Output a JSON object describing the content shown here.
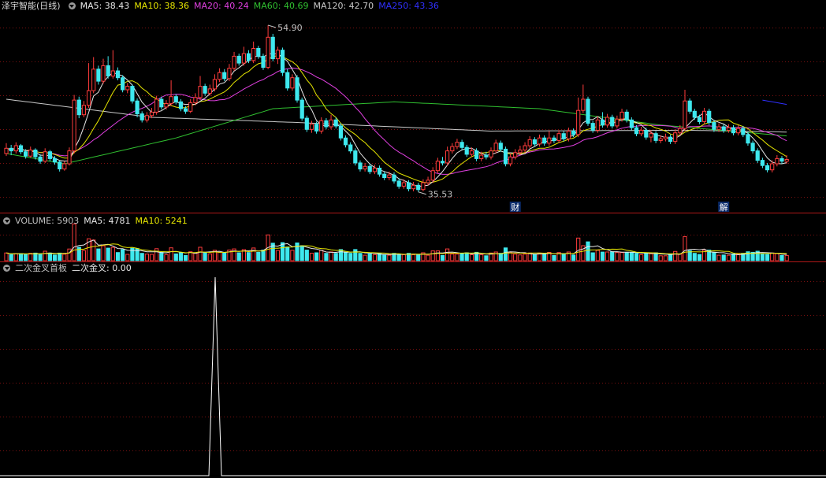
{
  "panel_main": {
    "title": "泽宇智能(日线)",
    "ma_labels": [
      {
        "text": "MA5: 38.43",
        "color": "#e8e8e8"
      },
      {
        "text": "MA10: 38.36",
        "color": "#e6e600"
      },
      {
        "text": "MA20: 40.24",
        "color": "#e040e0"
      },
      {
        "text": "MA60: 40.69",
        "color": "#30c030"
      },
      {
        "text": "MA120: 42.70",
        "color": "#c8c8c8"
      },
      {
        "text": "MA250: 43.36",
        "color": "#3030ff"
      }
    ],
    "high_label": "54.90",
    "low_label": "35.53",
    "markers": [
      "财",
      "解"
    ]
  },
  "panel_volume": {
    "labels": [
      {
        "text": "VOLUME: 5903",
        "color": "#c0c0c0"
      },
      {
        "text": "MA5: 4781",
        "color": "#e8e8e8"
      },
      {
        "text": "MA10: 5241",
        "color": "#e6e600"
      }
    ]
  },
  "panel_indicator": {
    "labels": [
      {
        "text": "二次金叉首板",
        "color": "#c0c0c0"
      },
      {
        "text": "二次金叉: 0.00",
        "color": "#e8e8e8"
      }
    ]
  },
  "colors": {
    "up": "#ff3c3c",
    "down": "#3ee8ee",
    "grid": "#7a1010",
    "separator": "#b01818",
    "spike": "#ffffff"
  },
  "chart_data": {
    "type": "candlestick",
    "price_range": [
      35.53,
      54.9
    ],
    "grid": "dotted horizontal",
    "candles": [
      [
        40.0,
        40.6,
        41.2,
        39.7
      ],
      [
        40.6,
        40.3,
        41.0,
        39.8
      ],
      [
        40.3,
        40.9,
        41.3,
        40.0
      ],
      [
        40.9,
        40.2,
        41.1,
        39.9
      ],
      [
        40.2,
        39.7,
        40.5,
        39.4
      ],
      [
        39.7,
        40.4,
        40.8,
        39.5
      ],
      [
        40.4,
        39.6,
        40.6,
        39.3
      ],
      [
        39.6,
        39.1,
        39.9,
        38.8
      ],
      [
        39.1,
        40.2,
        40.6,
        38.9
      ],
      [
        40.2,
        39.4,
        40.4,
        39.1
      ],
      [
        39.4,
        39.0,
        39.7,
        38.7
      ],
      [
        39.0,
        38.2,
        39.2,
        37.9
      ],
      [
        38.2,
        38.8,
        39.1,
        38.0
      ],
      [
        38.8,
        40.3,
        40.7,
        38.6
      ],
      [
        40.3,
        46.2,
        46.8,
        40.0
      ],
      [
        46.2,
        44.5,
        46.6,
        44.1
      ],
      [
        44.5,
        45.6,
        46.1,
        44.2
      ],
      [
        45.6,
        47.3,
        50.5,
        45.3
      ],
      [
        47.3,
        49.8,
        51.2,
        47.0
      ],
      [
        49.8,
        48.4,
        50.2,
        48.0
      ],
      [
        48.4,
        50.2,
        51.0,
        48.1
      ],
      [
        50.2,
        49.0,
        51.3,
        48.7
      ],
      [
        49.0,
        49.6,
        52.0,
        48.7
      ],
      [
        49.6,
        48.8,
        50.0,
        48.5
      ],
      [
        48.8,
        47.4,
        49.1,
        47.1
      ],
      [
        47.4,
        47.8,
        48.2,
        47.0
      ],
      [
        47.8,
        46.1,
        48.0,
        45.8
      ],
      [
        46.1,
        44.6,
        46.4,
        44.2
      ],
      [
        44.6,
        43.9,
        44.9,
        43.6
      ],
      [
        43.9,
        44.4,
        44.8,
        43.6
      ],
      [
        44.4,
        44.8,
        45.3,
        44.1
      ],
      [
        44.8,
        46.3,
        46.7,
        44.5
      ],
      [
        46.3,
        45.4,
        46.6,
        45.1
      ],
      [
        45.4,
        45.8,
        46.2,
        45.1
      ],
      [
        45.8,
        46.6,
        48.5,
        45.5
      ],
      [
        46.6,
        46.0,
        46.9,
        45.7
      ],
      [
        46.0,
        45.2,
        46.3,
        44.9
      ],
      [
        45.2,
        44.9,
        45.5,
        44.6
      ],
      [
        44.9,
        45.9,
        46.3,
        44.7
      ],
      [
        45.9,
        46.5,
        47.0,
        45.6
      ],
      [
        46.5,
        47.8,
        49.0,
        46.2
      ],
      [
        47.8,
        47.0,
        48.1,
        46.7
      ],
      [
        47.0,
        47.5,
        48.0,
        46.7
      ],
      [
        47.5,
        48.6,
        49.2,
        47.2
      ],
      [
        48.6,
        49.4,
        49.9,
        48.3
      ],
      [
        49.4,
        48.7,
        49.8,
        48.4
      ],
      [
        48.7,
        49.9,
        50.4,
        48.4
      ],
      [
        49.9,
        51.3,
        51.8,
        49.6
      ],
      [
        51.3,
        50.5,
        51.6,
        50.2
      ],
      [
        50.5,
        51.6,
        52.4,
        50.2
      ],
      [
        51.6,
        50.8,
        52.0,
        50.5
      ],
      [
        50.8,
        52.2,
        53.0,
        50.5
      ],
      [
        52.2,
        51.3,
        52.5,
        51.0
      ],
      [
        51.3,
        50.0,
        51.6,
        49.7
      ],
      [
        50.0,
        53.5,
        54.9,
        49.8
      ],
      [
        53.5,
        51.0,
        53.9,
        50.7
      ],
      [
        51.0,
        52.0,
        52.4,
        50.4
      ],
      [
        52.0,
        49.4,
        52.3,
        49.0
      ],
      [
        49.4,
        47.6,
        49.8,
        47.3
      ],
      [
        47.6,
        48.8,
        49.2,
        47.3
      ],
      [
        48.8,
        46.2,
        49.1,
        45.9
      ],
      [
        46.2,
        44.1,
        46.5,
        43.8
      ],
      [
        44.1,
        42.8,
        44.4,
        42.5
      ],
      [
        42.8,
        43.4,
        43.8,
        42.4
      ],
      [
        43.4,
        42.6,
        43.7,
        42.3
      ],
      [
        42.6,
        43.8,
        44.2,
        42.3
      ],
      [
        43.8,
        43.1,
        44.1,
        42.8
      ],
      [
        43.1,
        43.9,
        44.5,
        42.8
      ],
      [
        43.9,
        43.2,
        44.2,
        42.9
      ],
      [
        43.2,
        41.8,
        43.5,
        41.5
      ],
      [
        41.8,
        41.0,
        42.1,
        40.7
      ],
      [
        41.0,
        40.3,
        41.3,
        40.0
      ],
      [
        40.3,
        38.9,
        40.6,
        38.6
      ],
      [
        38.9,
        38.2,
        39.2,
        37.9
      ],
      [
        38.2,
        38.5,
        38.9,
        37.9
      ],
      [
        38.5,
        37.9,
        38.8,
        37.6
      ],
      [
        37.9,
        38.3,
        38.7,
        37.6
      ],
      [
        38.3,
        37.6,
        38.6,
        37.3
      ],
      [
        37.6,
        37.2,
        37.9,
        36.9
      ],
      [
        37.2,
        37.5,
        37.9,
        36.9
      ],
      [
        37.5,
        36.8,
        37.8,
        36.5
      ],
      [
        36.8,
        36.2,
        37.1,
        35.9
      ],
      [
        36.2,
        36.6,
        37.0,
        35.9
      ],
      [
        36.6,
        35.9,
        36.9,
        35.6
      ],
      [
        35.9,
        36.3,
        36.7,
        35.6
      ],
      [
        36.3,
        35.8,
        36.6,
        35.53
      ],
      [
        35.8,
        36.6,
        37.0,
        35.6
      ],
      [
        36.6,
        36.9,
        37.3,
        36.3
      ],
      [
        36.9,
        38.0,
        38.4,
        36.6
      ],
      [
        38.0,
        39.1,
        39.5,
        37.7
      ],
      [
        39.1,
        38.9,
        39.6,
        38.6
      ],
      [
        38.9,
        40.3,
        40.8,
        38.6
      ],
      [
        40.3,
        40.8,
        41.2,
        40.0
      ],
      [
        40.8,
        41.3,
        41.7,
        40.5
      ],
      [
        41.3,
        40.7,
        41.6,
        40.4
      ],
      [
        40.7,
        39.9,
        41.0,
        39.6
      ],
      [
        39.9,
        40.3,
        40.7,
        39.6
      ],
      [
        40.3,
        39.4,
        40.6,
        39.1
      ],
      [
        39.4,
        39.8,
        40.2,
        39.1
      ],
      [
        39.8,
        39.6,
        40.2,
        39.3
      ],
      [
        39.6,
        40.3,
        40.7,
        39.3
      ],
      [
        40.3,
        41.2,
        41.6,
        40.0
      ],
      [
        41.2,
        40.5,
        41.5,
        40.2
      ],
      [
        40.5,
        38.8,
        40.8,
        38.5
      ],
      [
        38.8,
        39.6,
        40.0,
        38.5
      ],
      [
        39.6,
        40.1,
        40.5,
        39.3
      ],
      [
        40.1,
        40.4,
        40.9,
        39.8
      ],
      [
        40.4,
        40.9,
        41.3,
        40.1
      ],
      [
        40.9,
        41.6,
        42.0,
        40.6
      ],
      [
        41.6,
        41.1,
        41.9,
        40.8
      ],
      [
        41.1,
        41.8,
        42.2,
        40.8
      ],
      [
        41.8,
        41.2,
        42.1,
        40.9
      ],
      [
        41.2,
        41.8,
        42.6,
        40.9
      ],
      [
        41.8,
        41.5,
        42.1,
        41.2
      ],
      [
        41.5,
        42.3,
        42.7,
        41.2
      ],
      [
        42.3,
        41.7,
        42.6,
        41.4
      ],
      [
        41.7,
        42.6,
        43.0,
        41.4
      ],
      [
        42.6,
        42.2,
        42.9,
        41.9
      ],
      [
        42.2,
        45.0,
        46.5,
        41.9
      ],
      [
        45.0,
        46.3,
        48.0,
        44.7
      ],
      [
        46.3,
        43.5,
        46.6,
        43.2
      ],
      [
        43.5,
        42.7,
        43.8,
        42.4
      ],
      [
        42.7,
        43.9,
        44.3,
        42.4
      ],
      [
        43.9,
        43.3,
        44.8,
        43.0
      ],
      [
        43.3,
        44.2,
        44.6,
        43.0
      ],
      [
        44.2,
        43.2,
        44.5,
        42.9
      ],
      [
        43.2,
        44.0,
        44.4,
        42.9
      ],
      [
        44.0,
        44.8,
        45.2,
        43.7
      ],
      [
        44.8,
        43.9,
        45.1,
        43.6
      ],
      [
        43.9,
        43.0,
        44.2,
        42.7
      ],
      [
        43.0,
        42.3,
        43.3,
        42.0
      ],
      [
        42.3,
        42.7,
        43.1,
        42.0
      ],
      [
        42.7,
        41.9,
        43.0,
        41.6
      ],
      [
        41.9,
        42.3,
        42.7,
        41.3
      ],
      [
        42.3,
        41.5,
        42.6,
        41.2
      ],
      [
        41.5,
        41.7,
        42.1,
        41.2
      ],
      [
        41.7,
        41.9,
        42.3,
        41.4
      ],
      [
        41.9,
        41.4,
        42.2,
        41.1
      ],
      [
        41.4,
        42.4,
        42.8,
        41.1
      ],
      [
        42.4,
        42.9,
        43.3,
        42.1
      ],
      [
        42.9,
        46.1,
        47.4,
        42.6
      ],
      [
        46.1,
        44.9,
        46.4,
        44.6
      ],
      [
        44.9,
        44.2,
        45.2,
        43.9
      ],
      [
        44.2,
        43.7,
        44.5,
        43.4
      ],
      [
        43.7,
        44.9,
        45.3,
        43.4
      ],
      [
        44.9,
        43.6,
        45.2,
        43.3
      ],
      [
        43.6,
        42.8,
        43.9,
        42.5
      ],
      [
        42.8,
        43.1,
        43.5,
        42.5
      ],
      [
        43.1,
        42.7,
        43.4,
        42.4
      ],
      [
        42.7,
        43.0,
        43.4,
        42.4
      ],
      [
        43.0,
        42.4,
        43.3,
        42.1
      ],
      [
        42.4,
        42.9,
        43.3,
        42.1
      ],
      [
        42.9,
        42.2,
        43.2,
        41.9
      ],
      [
        42.2,
        41.2,
        42.5,
        40.9
      ],
      [
        41.2,
        40.3,
        41.5,
        40.0
      ],
      [
        40.3,
        39.2,
        40.6,
        38.9
      ],
      [
        39.2,
        38.6,
        39.5,
        38.3
      ],
      [
        38.6,
        38.1,
        38.9,
        37.8
      ],
      [
        38.1,
        38.8,
        39.2,
        37.8
      ],
      [
        38.8,
        39.4,
        39.8,
        38.5
      ],
      [
        39.4,
        39.1,
        39.7,
        38.8
      ],
      [
        39.1,
        39.3,
        39.8,
        38.8
      ]
    ],
    "indicator": "二次金叉 spike at bar 39 (value 1), otherwise 0"
  }
}
